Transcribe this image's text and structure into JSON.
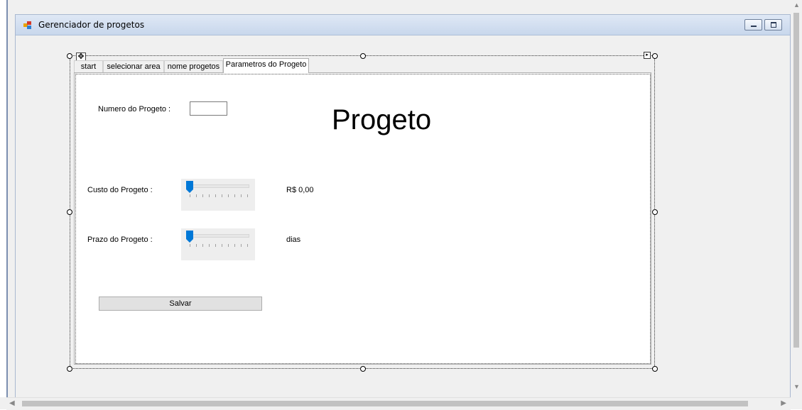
{
  "window": {
    "title": "Gerenciador de progetos"
  },
  "tabs": [
    {
      "label": "start",
      "active": false
    },
    {
      "label": "selecionar area",
      "active": false
    },
    {
      "label": "nome progetos",
      "active": false
    },
    {
      "label": "Parametros do Progeto",
      "active": true
    }
  ],
  "form": {
    "heading": "Progeto",
    "numero_label": "Numero do Progeto  :",
    "numero_value": "",
    "custo_label": "Custo do Progeto  :",
    "custo_value_text": "R$ 0,00",
    "custo_slider_value": 0,
    "prazo_label": "Prazo do Progeto  :",
    "prazo_value_text": "dias",
    "prazo_slider_value": 0,
    "save_label": "Salvar"
  },
  "colors": {
    "slider_thumb": "#0078d7",
    "title_bar": "#c8d7ec"
  },
  "icons": {
    "app": "form-app-icon",
    "move": "move-arrows-icon",
    "smart_tag": "smart-tag-arrow-icon"
  }
}
